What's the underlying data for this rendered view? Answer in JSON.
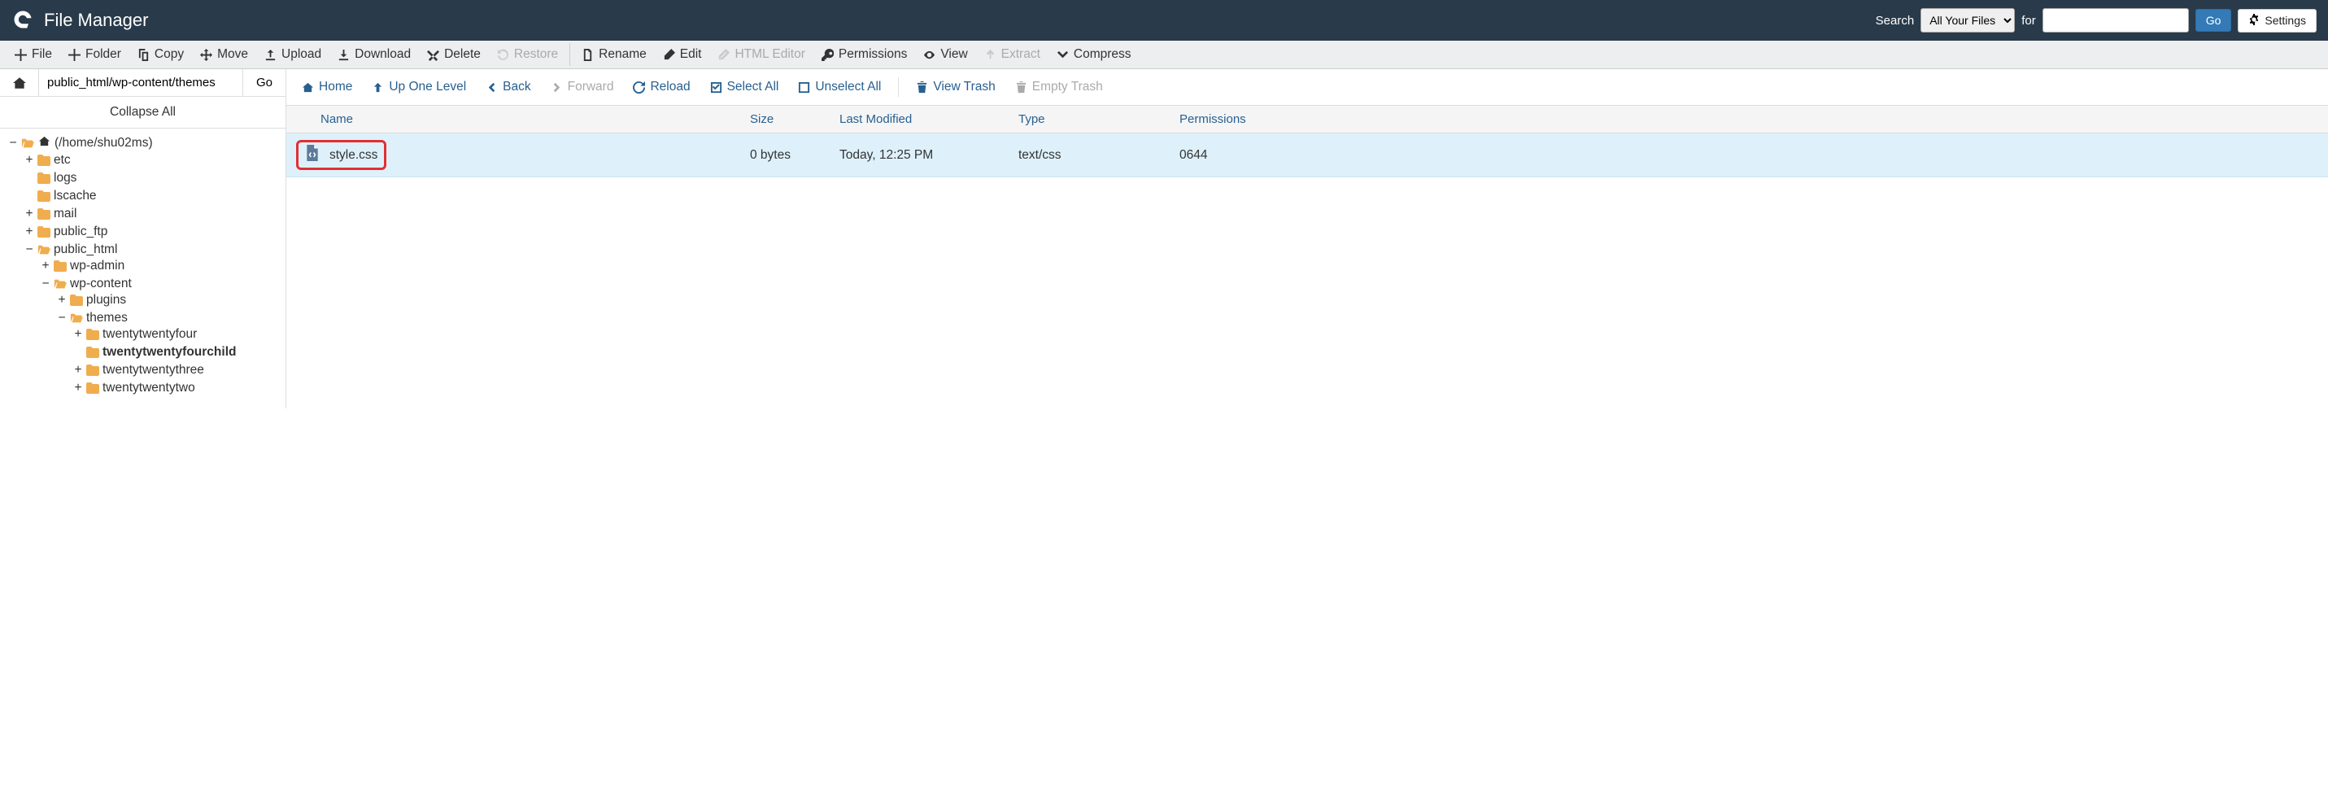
{
  "header": {
    "title": "File Manager",
    "search_label": "Search",
    "for_label": "for",
    "search_scope": "All Your Files",
    "go_label": "Go",
    "settings_label": "Settings"
  },
  "toolbar": {
    "file": "File",
    "folder": "Folder",
    "copy": "Copy",
    "move": "Move",
    "upload": "Upload",
    "download": "Download",
    "delete": "Delete",
    "restore": "Restore",
    "rename": "Rename",
    "edit": "Edit",
    "html_editor": "HTML Editor",
    "permissions": "Permissions",
    "view": "View",
    "extract": "Extract",
    "compress": "Compress"
  },
  "path": {
    "value": "public_html/wp-content/themes",
    "go": "Go"
  },
  "nav": {
    "collapse_all": "Collapse All",
    "home": "Home",
    "up": "Up One Level",
    "back": "Back",
    "forward": "Forward",
    "reload": "Reload",
    "select_all": "Select All",
    "unselect_all": "Unselect All",
    "view_trash": "View Trash",
    "empty_trash": "Empty Trash"
  },
  "columns": {
    "name": "Name",
    "size": "Size",
    "modified": "Last Modified",
    "type": "Type",
    "permissions": "Permissions"
  },
  "files": [
    {
      "name": "style.css",
      "size": "0 bytes",
      "modified": "Today, 12:25 PM",
      "type": "text/css",
      "permissions": "0644"
    }
  ],
  "tree": {
    "root": "(/home/shu02ms)",
    "etc": "etc",
    "logs": "logs",
    "lscache": "lscache",
    "mail": "mail",
    "public_ftp": "public_ftp",
    "public_html": "public_html",
    "wp_admin": "wp-admin",
    "wp_content": "wp-content",
    "plugins": "plugins",
    "themes": "themes",
    "twentytwentyfour": "twentytwentyfour",
    "twentytwentyfourchild": "twentytwentyfourchild",
    "twentytwentythree": "twentytwentythree",
    "twentytwentytwo": "twentytwentytwo"
  }
}
